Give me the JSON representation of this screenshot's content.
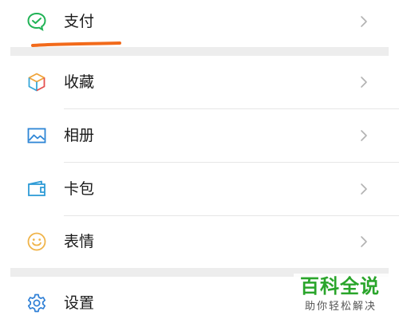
{
  "menu": {
    "pay": {
      "label": "支付",
      "icon": "wechat-pay-icon"
    },
    "favorites": {
      "label": "收藏",
      "icon": "cube-icon"
    },
    "album": {
      "label": "相册",
      "icon": "image-icon"
    },
    "cards": {
      "label": "卡包",
      "icon": "wallet-icon"
    },
    "stickers": {
      "label": "表情",
      "icon": "smiley-icon"
    },
    "settings": {
      "label": "设置",
      "icon": "gear-icon"
    }
  },
  "watermark": {
    "title": "百科全说",
    "subtitle": "助你轻松解决"
  },
  "colors": {
    "pay_green": "#21b356",
    "annotation_orange": "#f26a1b",
    "separator_gray": "#ededed",
    "watermark_green": "#2aa52b",
    "settings_blue": "#2e7fd6"
  }
}
